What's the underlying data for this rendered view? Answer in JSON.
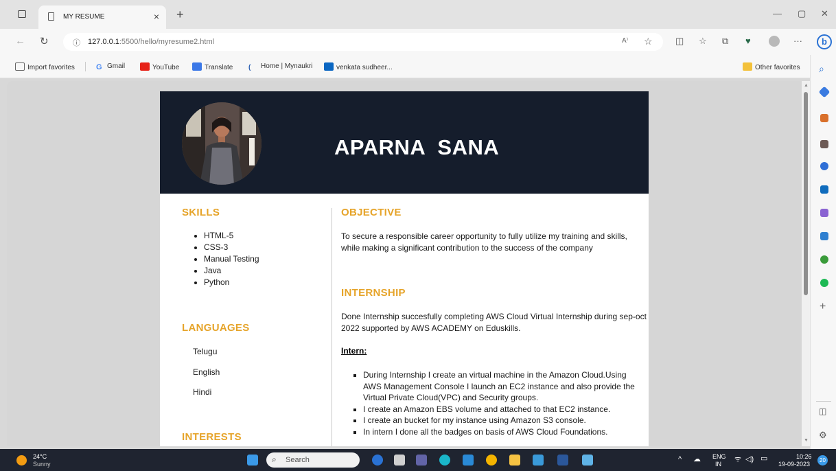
{
  "browser": {
    "tab_title": "MY RESUME",
    "tab_close": "×",
    "new_tab": "+",
    "url_host": "127.0.0.1",
    "url_rest": ":5500/hello/myresume2.html",
    "favorites": [
      {
        "label": "Import favorites",
        "color": "#666666"
      },
      {
        "label": "Gmail",
        "color": "#4285f4"
      },
      {
        "label": "YouTube",
        "color": "#e62117"
      },
      {
        "label": "Translate",
        "color": "#3b78e7"
      },
      {
        "label": "Home | Mynaukri",
        "color": "#2b5fb3"
      },
      {
        "label": "venkata sudheer...",
        "color": "#0a66c2"
      }
    ],
    "other_favorites": "Other favorites"
  },
  "resume": {
    "name": "APARNA  SANA",
    "skills_heading": "SKILLS",
    "skills": [
      "HTML-5",
      "CSS-3",
      "Manual Testing",
      "Java",
      "Python"
    ],
    "languages_heading": "LANGUAGES",
    "languages": [
      "Telugu",
      "English",
      "Hindi"
    ],
    "interests_heading": "INTERESTS",
    "objective_heading": "OBJECTIVE",
    "objective_text": "To secure a responsible career opportunity to fully utilize my training and skills, while making a significant contribution to the success of the company",
    "internship_heading": "INTERNSHIP",
    "internship_text": "Done Internship succesfully completing AWS Cloud Virtual Internship during sep-oct 2022 supported by AWS ACADEMY on Eduskills.",
    "intern_label": "Intern:",
    "intern_points": [
      "During Internship I create an virtual machine in the Amazon Cloud.Using AWS Management Console I launch an EC2 instance and also provide the Virtual Private Cloud(VPC) and Security groups.",
      "I create an Amazon EBS volume and attached to that EC2 instance.",
      "I create an bucket for my instance using Amazon S3 console.",
      "In intern I done all the badges on basis of AWS Cloud Foundations."
    ]
  },
  "taskbar": {
    "temp": "24°C",
    "weather": "Sunny",
    "search_placeholder": "Search",
    "lang_top": "ENG",
    "lang_bottom": "IN",
    "time": "10:26",
    "date": "19-09-2023",
    "notif_count": "20"
  },
  "colors": {
    "banner": "#151d2c",
    "heading_accent": "#e6a42a"
  }
}
